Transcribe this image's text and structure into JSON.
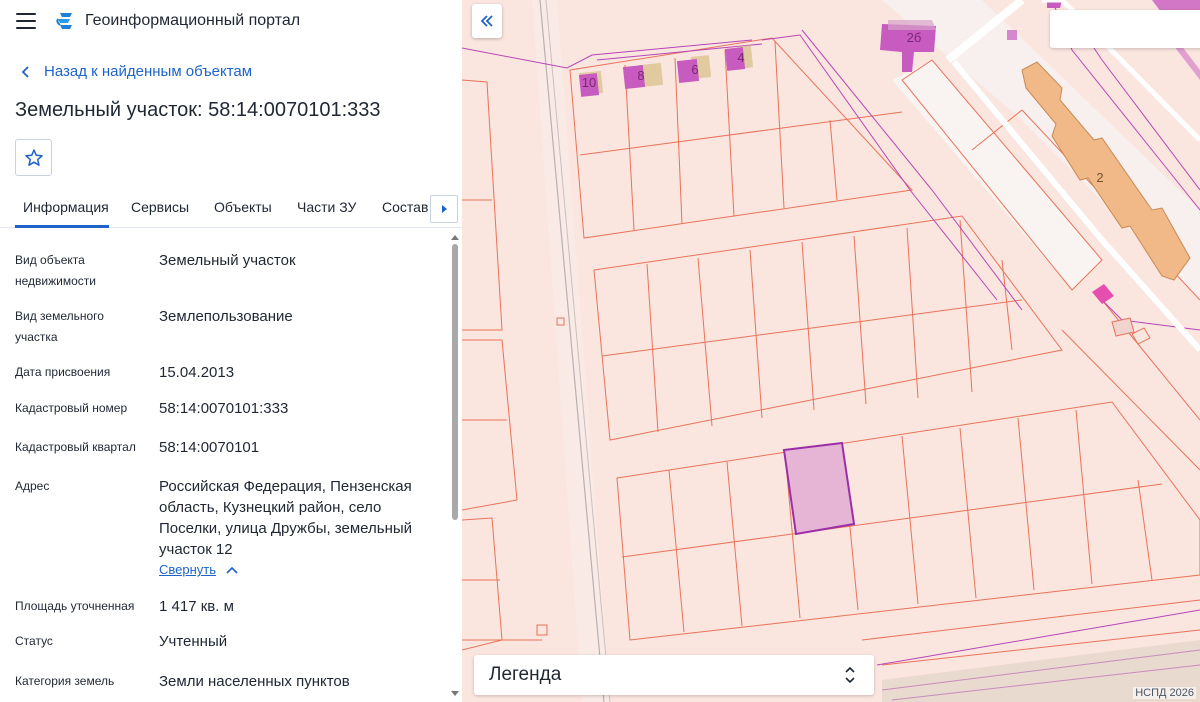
{
  "header": {
    "menu_icon": "hamburger-icon",
    "logo_icon": "portal-logo-icon",
    "title": "Геоинформационный портал"
  },
  "nav": {
    "back_label": "Назад к найденным объектам"
  },
  "object": {
    "title": "Земельный участок: 58:14:0070101:333",
    "favorite_icon": "star-icon"
  },
  "tabs": [
    {
      "label": "Информация",
      "active": true
    },
    {
      "label": "Сервисы"
    },
    {
      "label": "Объекты"
    },
    {
      "label": "Части ЗУ"
    },
    {
      "label": "Состав"
    }
  ],
  "info": {
    "rows": [
      {
        "label": "Вид объекта недвижимости",
        "value": "Земельный участок"
      },
      {
        "label": "Вид земельного участка",
        "value": "Землепользование"
      },
      {
        "label": "Дата присвоения",
        "value": "15.04.2013"
      },
      {
        "label": "Кадастровый номер",
        "value": "58:14:0070101:333"
      },
      {
        "label": "Кадастровый квартал",
        "value": "58:14:0070101"
      },
      {
        "label": "Адрес",
        "value": "Российская Федерация, Пензенская область, Кузнецкий район, село Поселки, улица Дружбы, земельный участок 12"
      },
      {
        "label": "Площадь уточненная",
        "value": "1 417 кв. м"
      },
      {
        "label": "Статус",
        "value": "Учтенный"
      },
      {
        "label": "Категория земель",
        "value": "Земли населенных пунктов"
      }
    ],
    "collapse_label": "Свернуть"
  },
  "map": {
    "building_labels": [
      "10",
      "8",
      "6",
      "4",
      "2б",
      "2"
    ],
    "legend_label": "Легенда",
    "copyright": "НСПД 2026",
    "colors": {
      "background": "#fbe5df",
      "parcel_line": "#e8735a",
      "selected_fill": "#e6b4d4",
      "selected_stroke": "#9a2fa8",
      "building": "#c75bbf",
      "orange_building": "#f0b987"
    }
  }
}
